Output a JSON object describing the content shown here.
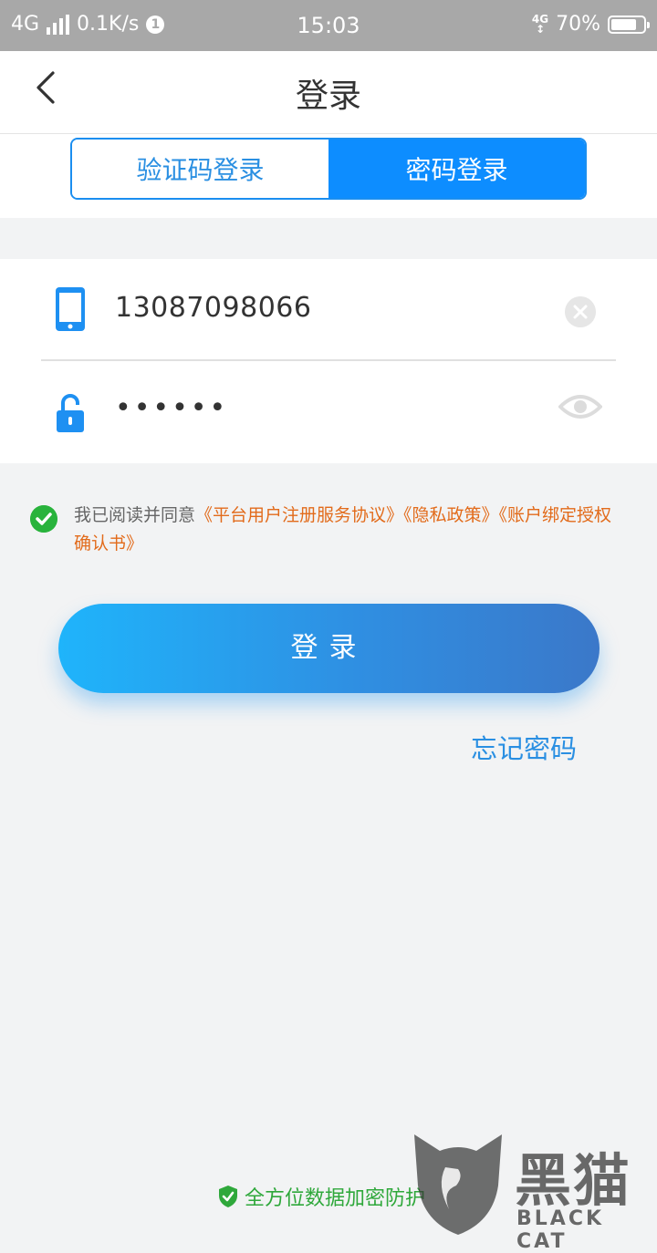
{
  "status_bar": {
    "network": "4G",
    "speed": "0.1K/s",
    "notification_count": "1",
    "time": "15:03",
    "network_right": "4G",
    "battery": "70%"
  },
  "header": {
    "title": "登录",
    "back_icon": "chevron-left-icon"
  },
  "tabs": [
    {
      "label": "验证码登录",
      "active": false
    },
    {
      "label": "密码登录",
      "active": true
    }
  ],
  "form": {
    "phone": {
      "value": "13087098066",
      "icon": "phone-icon",
      "action_icon": "clear-icon"
    },
    "password": {
      "value": "••••••",
      "icon": "lock-icon",
      "action_icon": "eye-icon"
    }
  },
  "agreement": {
    "prefix": "我已阅读并同意",
    "links": [
      "《平台用户注册服务协议》",
      "《隐私政策》",
      "《账户绑定授权确认书》"
    ],
    "checked": true
  },
  "login_button": {
    "label": "登录"
  },
  "forgot_password": {
    "label": "忘记密码"
  },
  "footer": {
    "security_text": "全方位数据加密防护"
  },
  "watermark": {
    "cn": "黑猫",
    "en": "BLACK CAT"
  },
  "colors": {
    "accent": "#0d8dff",
    "link_orange": "#e26b1b",
    "check_green": "#29b33c",
    "status_bar": "#a8a8a8"
  }
}
